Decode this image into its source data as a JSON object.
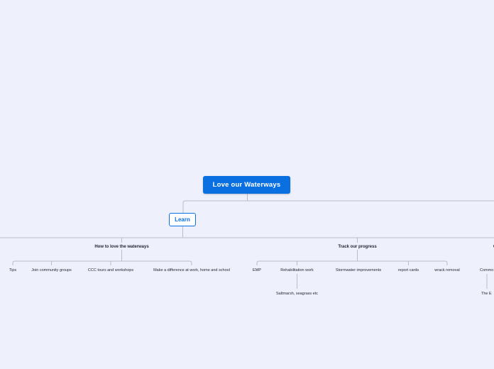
{
  "root": {
    "label": "Love our Waterways"
  },
  "branch": {
    "label": "Learn"
  },
  "topics": [
    {
      "label": "How to love the waterways",
      "children": [
        {
          "label": "Tips"
        },
        {
          "label": "Join community groups"
        },
        {
          "label": "CCC tours and workshops"
        },
        {
          "label": "Make a difference at work, home and school"
        }
      ]
    },
    {
      "label": "Track our progress",
      "children": [
        {
          "label": "EMP"
        },
        {
          "label": "Rehabilitation work"
        },
        {
          "label": "Stormwater improvements"
        },
        {
          "label": "report cards"
        },
        {
          "label": "wrack removal"
        }
      ],
      "grandchildren": [
        {
          "label": "Saltmarsh, seagrass etc"
        }
      ]
    },
    {
      "label": "C",
      "children": [
        {
          "label": "Commo"
        }
      ],
      "grandchildren": [
        {
          "label": "The E"
        }
      ]
    }
  ],
  "colors": {
    "background": "#eef1fb",
    "root_fill": "#0a6fe0",
    "branch_border": "#0a6fe0",
    "connector": "#b9bdc9"
  }
}
